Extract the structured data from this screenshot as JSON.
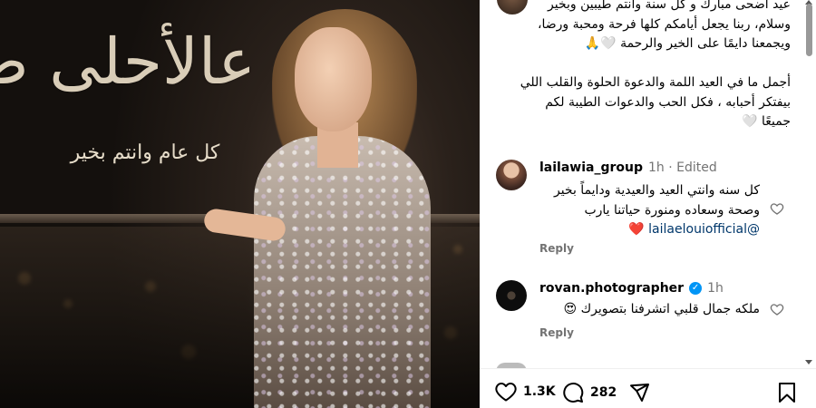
{
  "post_image": {
    "headline_art": "عالأحلى ضحى",
    "subline_art": "كل عام وانتم بخير"
  },
  "caption": {
    "lines": [
      "عيد أضحى مبارك و كل سنة وانتم طيبين وبخير وسلام، ربنا يجعل أيامكم كلها فرحة ومحبة ورضا، ويجمعنا دايمًا على الخير والرحمة 🤍🙏",
      "أجمل ما في العيد اللمة والدعوة الحلوة والقلب اللي بيفتكر أحبابه ، فكل الحب والدعوات الطيبة لكم جميعًا 🤍"
    ]
  },
  "comments": [
    {
      "username": "lailawia_group",
      "meta": "1h · Edited",
      "text": "كل سنه وانتي العيد والعيدية ودايماً بخير وصحة وسعاده ومنورة حياتنا يارب",
      "mention": "@lailaelouiofficial",
      "emoji": "❤️",
      "reply_label": "Reply"
    },
    {
      "username": "rovan.photographer",
      "meta": "1h",
      "verified": true,
      "text": "ملكه جمال قلبي اتشرفنا بتصويرك 😍",
      "reply_label": "Reply"
    }
  ],
  "actions": {
    "likes": "1.3K",
    "comments": "282"
  },
  "colors": {
    "meta_gray": "#737373",
    "verified_blue": "#0095f6",
    "mention_blue": "#00376b"
  }
}
